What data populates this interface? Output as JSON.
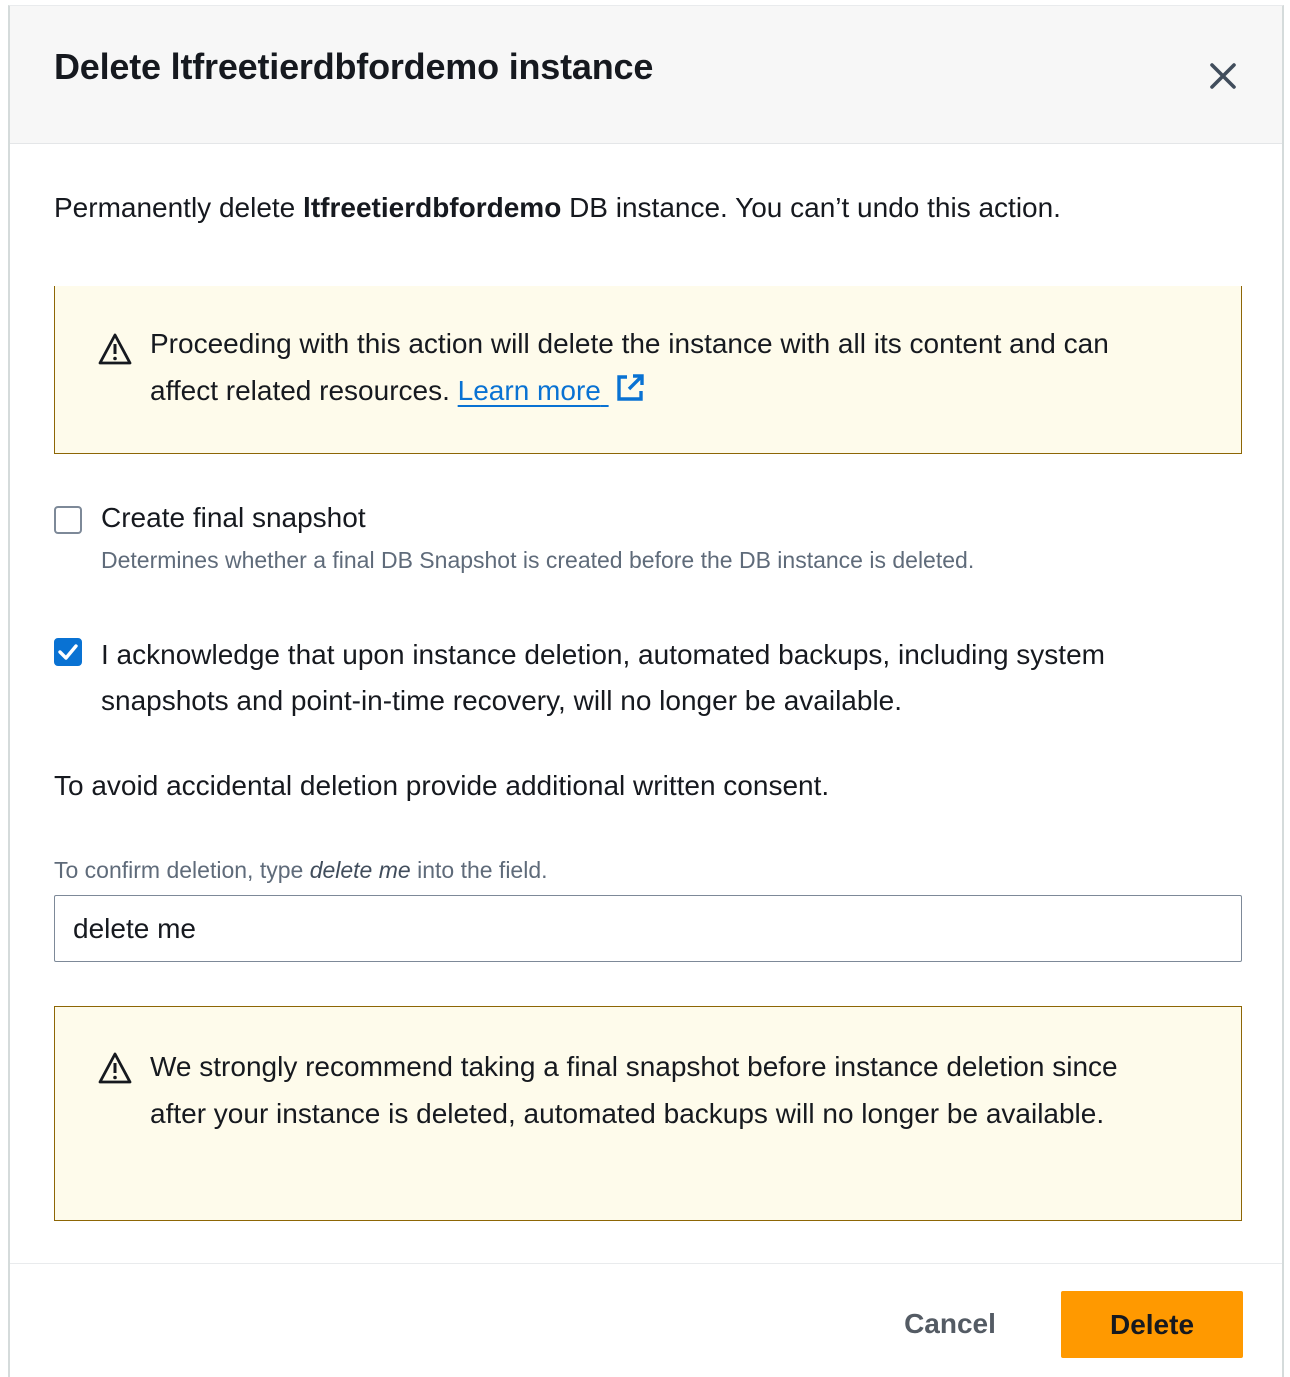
{
  "dialog": {
    "title": "Delete ltfreetierdbfordemo instance",
    "close_icon": "close-icon"
  },
  "intro": {
    "prefix": "Permanently delete ",
    "instance_name": "ltfreetierdbfordemo",
    "suffix": " DB instance. You can’t undo this action."
  },
  "warning_alert": {
    "icon": "warning-icon",
    "text": "Proceeding with this action will delete the instance with all its content and can affect related resources. ",
    "link_label": "Learn more",
    "link_icon": "external-link-icon"
  },
  "snapshot_option": {
    "label": "Create final snapshot",
    "description": "Determines whether a final DB Snapshot is created before the DB instance is deleted.",
    "checked": false
  },
  "acknowledge_option": {
    "label": "I acknowledge that upon instance deletion, automated backups, including system snapshots and point-in-time recovery, will no longer be available.",
    "checked": true
  },
  "consent_text": "To avoid accidental deletion provide additional written consent.",
  "confirm_field": {
    "label_prefix": "To confirm deletion, type ",
    "label_keyword": "delete me",
    "label_suffix": " into the field.",
    "value": "delete me"
  },
  "recommend_alert": {
    "icon": "warning-icon",
    "text": "We strongly recommend taking a final snapshot before instance deletion since after your instance is deleted, automated backups will no longer be available."
  },
  "footer": {
    "cancel_label": "Cancel",
    "delete_label": "Delete"
  },
  "colors": {
    "primary_button": "#ff9900",
    "link": "#0972d3",
    "alert_background": "#fefbeb",
    "alert_border": "#8d6605"
  }
}
